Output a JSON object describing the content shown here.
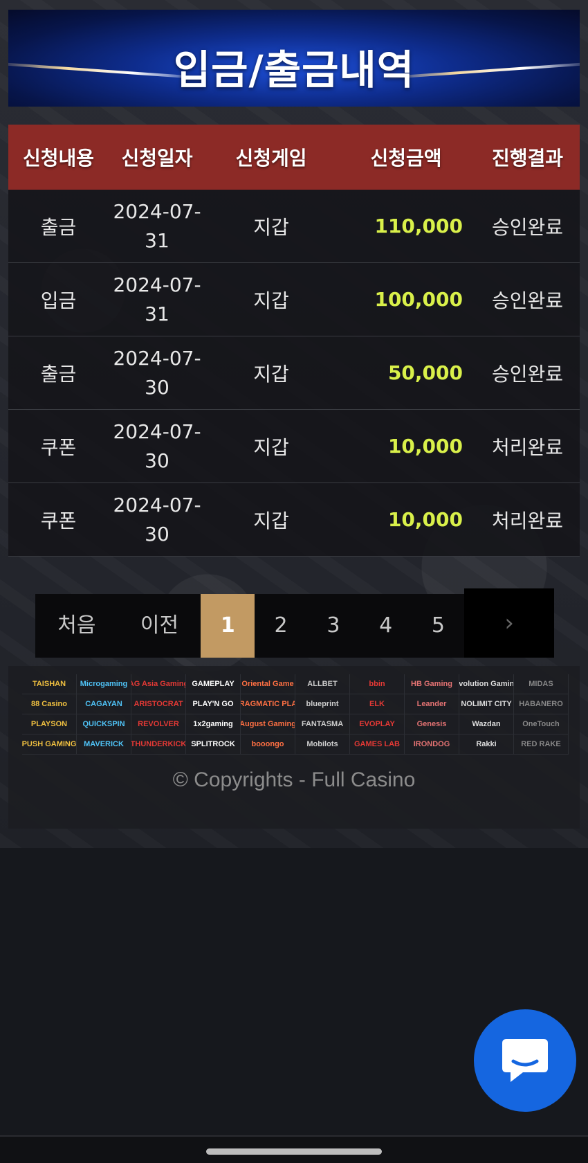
{
  "header": {
    "title": "입금/출금내역"
  },
  "table": {
    "columns": [
      "신청내용",
      "신청일자",
      "신청게임",
      "신청금액",
      "진행결과"
    ],
    "rows": [
      {
        "type": "출금",
        "date_line1": "2024-07-",
        "date_line2": "31",
        "game": "지갑",
        "amount": "110,000",
        "status": "승인완료"
      },
      {
        "type": "입금",
        "date_line1": "2024-07-",
        "date_line2": "31",
        "game": "지갑",
        "amount": "100,000",
        "status": "승인완료"
      },
      {
        "type": "출금",
        "date_line1": "2024-07-",
        "date_line2": "30",
        "game": "지갑",
        "amount": "50,000",
        "status": "승인완료"
      },
      {
        "type": "쿠폰",
        "date_line1": "2024-07-",
        "date_line2": "30",
        "game": "지갑",
        "amount": "10,000",
        "status": "처리완료"
      },
      {
        "type": "쿠폰",
        "date_line1": "2024-07-",
        "date_line2": "30",
        "game": "지갑",
        "amount": "10,000",
        "status": "처리완료"
      }
    ]
  },
  "pagination": {
    "first": "처음",
    "prev": "이전",
    "pages": [
      "1",
      "2",
      "3",
      "4",
      "5"
    ],
    "current": "1",
    "next_icon": "chevron-right-icon"
  },
  "footer": {
    "providers": [
      "TAISHAN",
      "Microgaming",
      "AG Asia Gaming",
      "GAMEPLAY",
      "Oriental Game",
      "ALLBET",
      "bbin",
      "HB Gaming",
      "Evolution Gaming",
      "MIDAS",
      "88 Casino",
      "CAGAYAN",
      "ARISTOCRAT",
      "PLAY'N GO",
      "PRAGMATIC PLAY",
      "blueprint",
      "ELK",
      "Leander",
      "NOLIMIT CITY",
      "HABANERO",
      "PLAYSON",
      "QUICKSPIN",
      "REVOLVER",
      "1x2gaming",
      "August Gaming",
      "FANTASMA",
      "EVOPLAY",
      "Genesis",
      "Wazdan",
      "OneTouch",
      "PUSH GAMING",
      "MAVERICK",
      "THUNDERKICK",
      "SPLITROCK",
      "booongo",
      "Mobilots",
      "GAMES LAB",
      "IRONDOG",
      "Rakki",
      "RED RAKE"
    ],
    "copyright": "© Copyrights - Full Casino"
  },
  "chat": {
    "icon": "chat-bubble-icon"
  },
  "colors": {
    "header_red": "#8c2a26",
    "amount": "#d9f04a",
    "active_page": "#c29a63",
    "chat": "#1566e0"
  }
}
